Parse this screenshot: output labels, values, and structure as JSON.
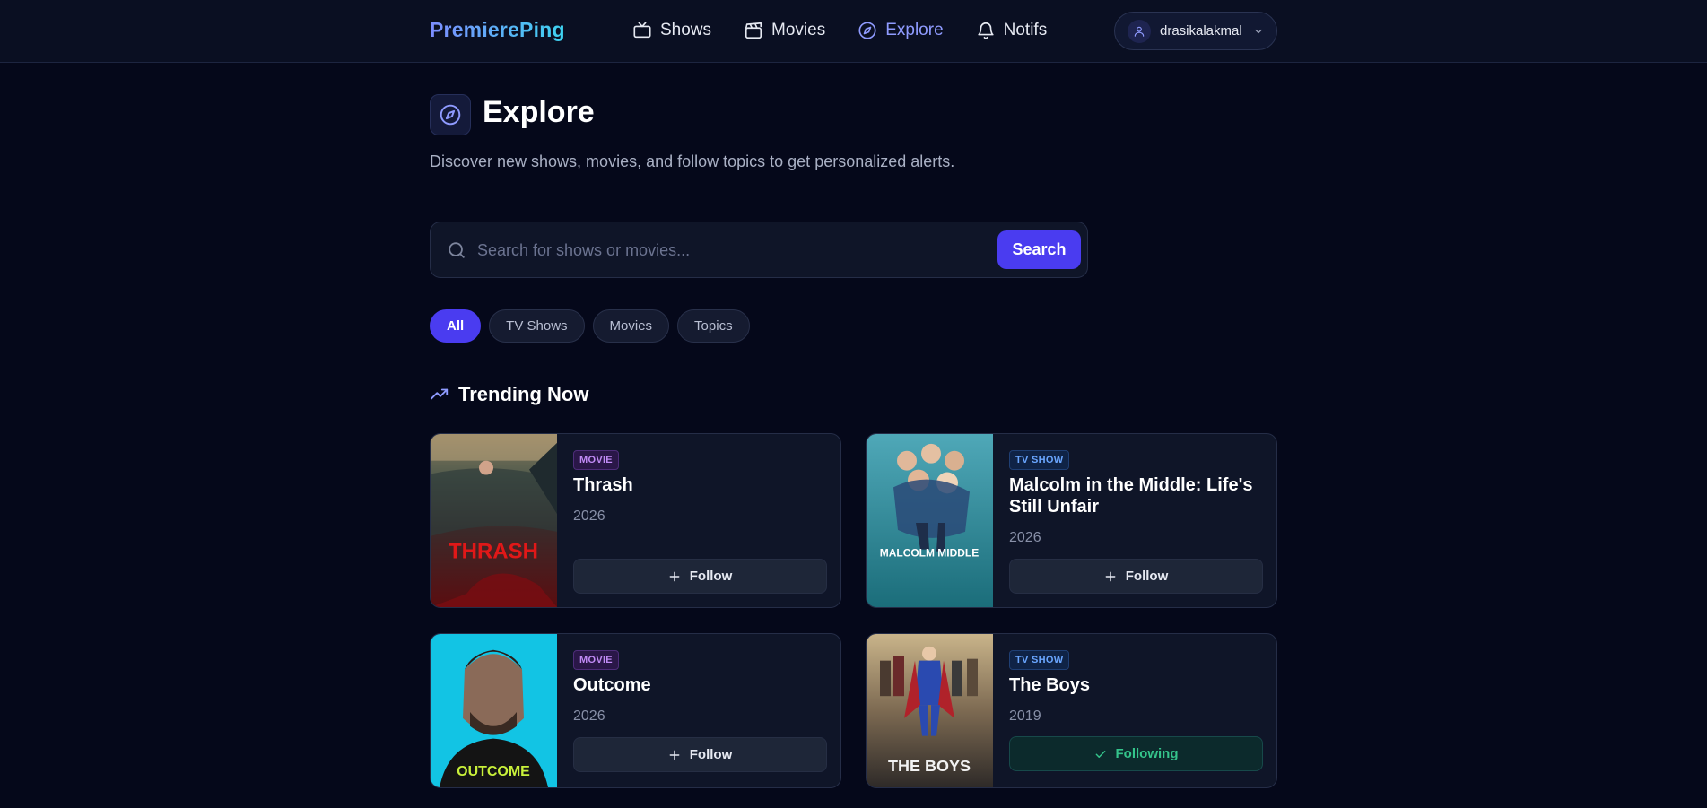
{
  "nav": {
    "brand": "PremierePing",
    "links": [
      {
        "label": "Shows",
        "icon": "tv-icon",
        "active": false
      },
      {
        "label": "Movies",
        "icon": "clapperboard-icon",
        "active": false
      },
      {
        "label": "Explore",
        "icon": "compass-icon",
        "active": true
      },
      {
        "label": "Notifs",
        "icon": "bell-icon",
        "active": false
      }
    ],
    "user": {
      "name": "drasikalakmal",
      "icon": "user-icon"
    }
  },
  "header": {
    "title": "Explore",
    "subtitle": "Discover new shows, movies, and follow topics to get personalized alerts."
  },
  "search": {
    "placeholder": "Search for shows or movies...",
    "value": "",
    "button_label": "Search"
  },
  "filters": [
    {
      "label": "All",
      "active": true
    },
    {
      "label": "TV Shows",
      "active": false
    },
    {
      "label": "Movies",
      "active": false
    },
    {
      "label": "Topics",
      "active": false
    }
  ],
  "trending": {
    "title": "Trending Now",
    "items": [
      {
        "type": "MOVIE",
        "title": "Thrash",
        "year": "2026",
        "follow_label": "Follow",
        "following": false,
        "poster_text": "THRASH"
      },
      {
        "type": "TV SHOW",
        "title": "Malcolm in the Middle: Life's Still Unfair",
        "year": "2026",
        "follow_label": "Follow",
        "following": false,
        "poster_text": "MALCOLM MIDDLE"
      },
      {
        "type": "MOVIE",
        "title": "Outcome",
        "year": "2026",
        "follow_label": "Follow",
        "following": false,
        "poster_text": "OUTCOME"
      },
      {
        "type": "TV SHOW",
        "title": "The Boys",
        "year": "2019",
        "follow_label": "Following",
        "following": true,
        "poster_text": "THE BOYS"
      }
    ]
  },
  "colors": {
    "background": "#05081a",
    "accent": "#4a3cf0",
    "active_link": "#8f9bff",
    "following_green": "#34c48b"
  }
}
